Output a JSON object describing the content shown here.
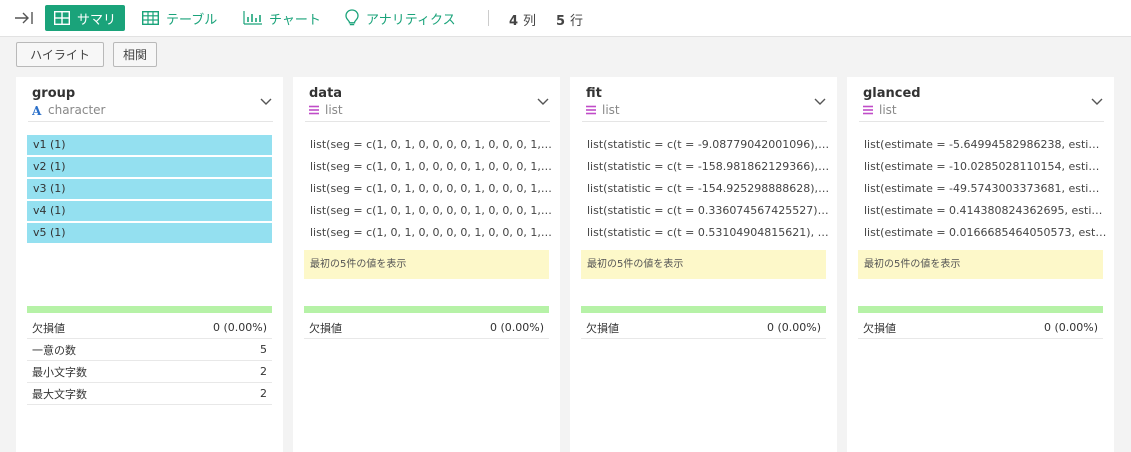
{
  "toolbar": {
    "tabs": [
      {
        "label": "サマリ",
        "icon": "grid-icon",
        "active": true
      },
      {
        "label": "テーブル",
        "icon": "table-icon",
        "active": false
      },
      {
        "label": "チャート",
        "icon": "bar-chart-icon",
        "active": false
      },
      {
        "label": "アナリティクス",
        "icon": "lightbulb-icon",
        "active": false
      }
    ],
    "columns_count": "4",
    "columns_unit": "列",
    "rows_count": "5",
    "rows_unit": "行",
    "accent_color": "#1aa37a"
  },
  "subbar": {
    "highlight_label": "ハイライト",
    "correlation_label": "相関"
  },
  "columns": [
    {
      "name": "group",
      "type": "character",
      "type_icon": "character-type-icon",
      "values": [
        "v1 (1)",
        "v2 (1)",
        "v3 (1)",
        "v4 (1)",
        "v5 (1)"
      ],
      "stats": [
        {
          "label": "欠損値",
          "value": "0 (0.00%)"
        },
        {
          "label": "一意の数",
          "value": "5"
        },
        {
          "label": "最小文字数",
          "value": "2"
        },
        {
          "label": "最大文字数",
          "value": "2"
        }
      ]
    },
    {
      "name": "data",
      "type": "list",
      "type_icon": "list-type-icon",
      "values": [
        "list(seg = c(1, 0, 1, 0, 0, 0, 0, 1, 0, 0, 0, 1, 0,...",
        "list(seg = c(1, 0, 1, 0, 0, 0, 0, 1, 0, 0, 0, 1, 0,...",
        "list(seg = c(1, 0, 1, 0, 0, 0, 0, 1, 0, 0, 0, 1, 0,...",
        "list(seg = c(1, 0, 1, 0, 0, 0, 0, 1, 0, 0, 0, 1, 0,...",
        "list(seg = c(1, 0, 1, 0, 0, 0, 0, 1, 0, 0, 0, 1, 0,..."
      ],
      "show_first": "最初の5件の値を表示",
      "stats": [
        {
          "label": "欠損値",
          "value": "0 (0.00%)"
        }
      ]
    },
    {
      "name": "fit",
      "type": "list",
      "type_icon": "list-type-icon",
      "values": [
        "list(statistic = c(t = -9.08779042001096), pa...",
        "list(statistic = c(t = -158.981862129366), pa...",
        "list(statistic = c(t = -154.925298888628), pa...",
        "list(statistic = c(t = 0.336074567425527), p...",
        "list(statistic = c(t = 0.53104904815621), par..."
      ],
      "show_first": "最初の5件の値を表示",
      "stats": [
        {
          "label": "欠損値",
          "value": "0 (0.00%)"
        }
      ]
    },
    {
      "name": "glanced",
      "type": "list",
      "type_icon": "list-type-icon",
      "values": [
        "list(estimate = -5.64994582986238, estimat...",
        "list(estimate = -10.0285028110154, estimat...",
        "list(estimate = -49.5743003373681, estimat...",
        "list(estimate = 0.414380824362695, estima...",
        "list(estimate = 0.0166685464050573, estim..."
      ],
      "show_first": "最初の5件の値を表示",
      "stats": [
        {
          "label": "欠損値",
          "value": "0 (0.00%)"
        }
      ]
    }
  ]
}
